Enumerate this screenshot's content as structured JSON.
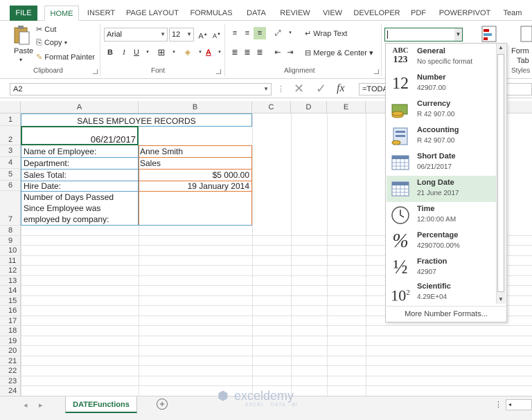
{
  "ribbon": {
    "tabs": [
      "FILE",
      "HOME",
      "INSERT",
      "PAGE LAYOUT",
      "FORMULAS",
      "DATA",
      "REVIEW",
      "VIEW",
      "DEVELOPER",
      "PDF",
      "POWERPIVOT",
      "Team"
    ],
    "active_tab": "HOME",
    "clipboard": {
      "label": "Clipboard",
      "paste": "Paste",
      "cut": "Cut",
      "copy": "Copy",
      "format_painter": "Format Painter"
    },
    "font": {
      "label": "Font",
      "name": "Arial",
      "size": "12"
    },
    "alignment": {
      "label": "Alignment",
      "wrap_text": "Wrap Text",
      "merge_center": "Merge & Center"
    },
    "styles": {
      "partial_format": "Form",
      "partial_table": "Tab",
      "partial_label": "Styles"
    }
  },
  "formula_bar": {
    "name_box": "A2",
    "formula_text": "=TODA"
  },
  "sheet": {
    "columns": [
      "A",
      "B",
      "C",
      "D",
      "E"
    ],
    "rows": [
      "1",
      "2",
      "3",
      "4",
      "5",
      "6",
      "7",
      "8",
      "9",
      "10",
      "11",
      "12",
      "13",
      "14",
      "15",
      "16",
      "17",
      "18",
      "19",
      "20",
      "21",
      "22",
      "23",
      "24"
    ],
    "cells": {
      "a1": "SALES EMPLOYEE RECORDS",
      "a2": "06/21/2017",
      "a3": "Name of Employee:",
      "b3": "Anne Smith",
      "a4": "Department:",
      "b4": "Sales",
      "a5": "Sales Total:",
      "b5": "$5 000.00",
      "a6": "Hire Date:",
      "b6": "19 January 2014",
      "a7_line1": "Number of Days Passed",
      "a7_line2": "Since Employee was",
      "a7_line3": "employed by company:"
    }
  },
  "sheet_tab": "DATEFunctions",
  "watermark": {
    "name": "exceldemy",
    "tagline": "EXCEL · DATA · BI"
  },
  "number_format_menu": {
    "items": [
      {
        "name": "General",
        "sample": "No specific format",
        "icon": "abc-123-icon"
      },
      {
        "name": "Number",
        "sample": "42907.00",
        "icon": "number-12-icon"
      },
      {
        "name": "Currency",
        "sample": "R 42 907.00",
        "icon": "currency-icon"
      },
      {
        "name": "Accounting",
        "sample": "R 42 907.00",
        "icon": "accounting-icon"
      },
      {
        "name": "Short Date",
        "sample": "06/21/2017",
        "icon": "short-date-icon"
      },
      {
        "name": "Long Date",
        "sample": "21 June 2017",
        "icon": "long-date-icon"
      },
      {
        "name": "Time",
        "sample": "12:00:00 AM",
        "icon": "clock-icon"
      },
      {
        "name": "Percentage",
        "sample": "4290700.00%",
        "icon": "percent-icon"
      },
      {
        "name": "Fraction",
        "sample": "42907",
        "icon": "fraction-icon"
      },
      {
        "name": "Scientific",
        "sample": "4.29E+04",
        "icon": "scientific-icon"
      }
    ],
    "highlighted": "Long Date",
    "more": "More Number Formats..."
  },
  "colors": {
    "accent": "#217346",
    "highlight": "#ddeedf",
    "border_blue": "#5aa0c8",
    "border_orange": "#e07b39"
  }
}
